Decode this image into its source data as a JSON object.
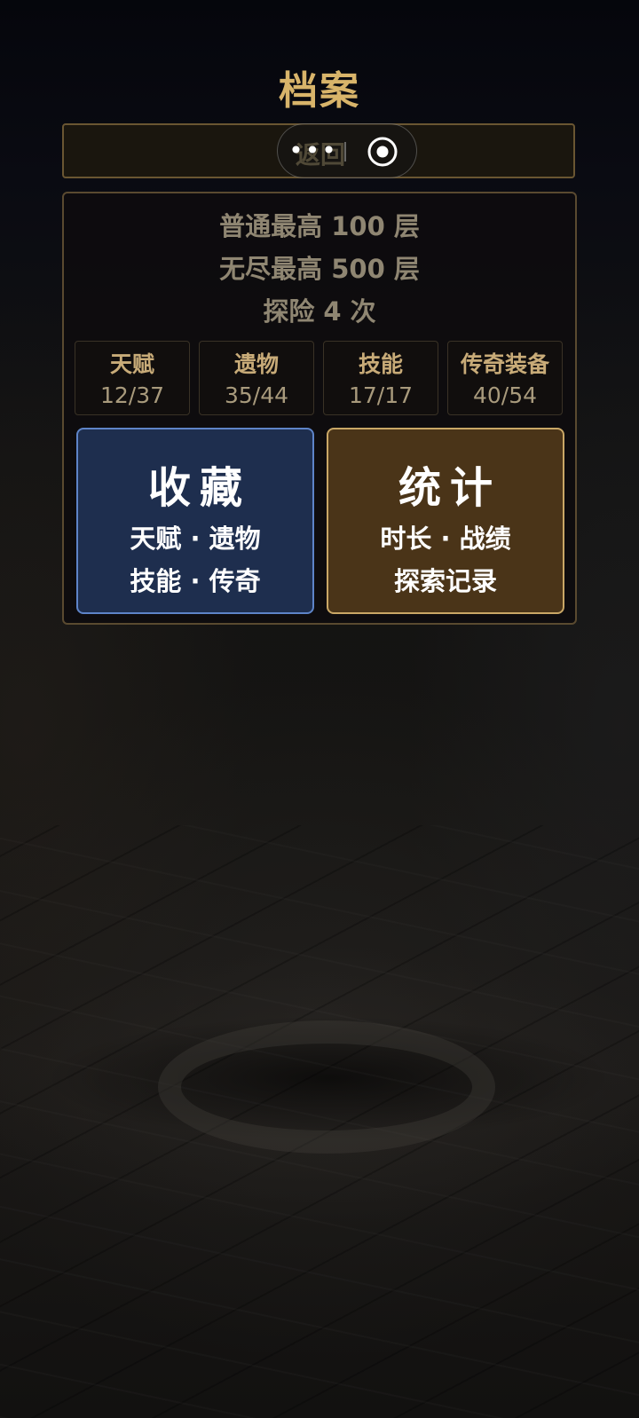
{
  "page": {
    "title": "档案"
  },
  "topbar": {
    "back_label": "返回",
    "capsule_menu_icon": "more-dots-icon",
    "capsule_close_icon": "target-circle-icon"
  },
  "stats": {
    "normal_best": "普通最高 100 层",
    "endless_best": "无尽最高 500 层",
    "adventures": "探险 4 次"
  },
  "counters": [
    {
      "label": "天赋",
      "value": "12/37"
    },
    {
      "label": "遗物",
      "value": "35/44"
    },
    {
      "label": "技能",
      "value": "17/17"
    },
    {
      "label": "传奇装备",
      "value": "40/54"
    }
  ],
  "buttons": {
    "collection": {
      "title": "收藏",
      "line1": "天赋 · 遗物",
      "line2": "技能 · 传奇",
      "color": "#1e2e4e",
      "border_color": "#5e84c8"
    },
    "statistics": {
      "title": "统计",
      "line1": "时长 · 战绩",
      "line2": "探索记录",
      "color": "#4a3418",
      "border_color": "#c9a766"
    }
  },
  "colors": {
    "title_gold": "#d8b46a",
    "panel_border": "#5a4a30"
  }
}
